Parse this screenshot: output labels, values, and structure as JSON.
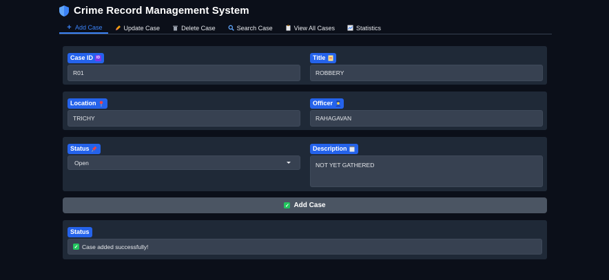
{
  "app": {
    "title": "Crime Record Management System",
    "title_icon": "shield-icon"
  },
  "tabs": [
    {
      "label": "Add Case",
      "icon": "plus-icon",
      "active": true
    },
    {
      "label": "Update Case",
      "icon": "pencil-icon",
      "active": false
    },
    {
      "label": "Delete Case",
      "icon": "trash-icon",
      "active": false
    },
    {
      "label": "Search Case",
      "icon": "magnifier-icon",
      "active": false
    },
    {
      "label": "View All Cases",
      "icon": "clipboard-icon",
      "active": false
    },
    {
      "label": "Statistics",
      "icon": "chart-icon",
      "active": false
    }
  ],
  "form": {
    "case_id": {
      "label": "Case ID",
      "icon": "id-icon",
      "value": "R01"
    },
    "title": {
      "label": "Title",
      "icon": "document-icon",
      "value": "ROBBERY"
    },
    "location": {
      "label": "Location",
      "icon": "pin-icon",
      "value": "TRICHY"
    },
    "officer": {
      "label": "Officer",
      "icon": "police-officer-icon",
      "value": "RAHAGAVAN"
    },
    "status": {
      "label": "Status",
      "icon": "pushpin-icon",
      "value": "Open"
    },
    "description": {
      "label": "Description",
      "icon": "notepad-icon",
      "value": "NOT YET GATHERED"
    }
  },
  "add_button": {
    "label": "Add Case",
    "icon": "checkmark-icon"
  },
  "status_output": {
    "label": "Status",
    "message": "Case added successfully!",
    "icon": "checkmark-icon"
  },
  "colors": {
    "background": "#0b0f19",
    "panel": "#1f2937",
    "input": "#374151",
    "accent": "#2563eb",
    "active_tab": "#3b82f6",
    "success": "#22c55e"
  }
}
